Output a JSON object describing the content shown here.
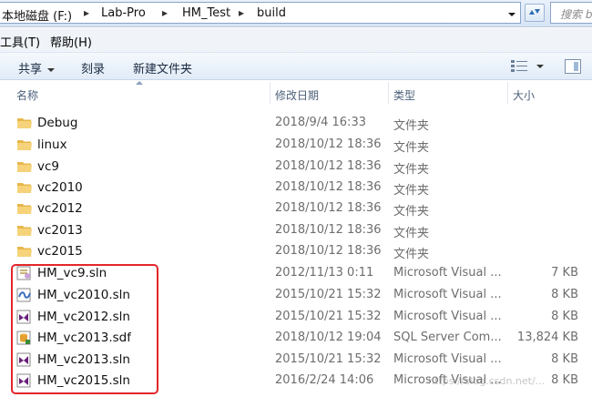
{
  "address": {
    "crumbs": [
      "本地磁盘 (F:)",
      "Lab-Pro",
      "HM_Test",
      "build"
    ],
    "search_placeholder": "搜索 b"
  },
  "menu": {
    "items": [
      "工具(T)",
      "帮助(H)"
    ]
  },
  "toolbar": {
    "share_label": "共享",
    "burn_label": "刻录",
    "new_folder_label": "新建文件夹"
  },
  "columns": {
    "name": "名称",
    "date": "修改日期",
    "type": "类型",
    "size": "大小"
  },
  "files": [
    {
      "name": "Debug",
      "date": "2018/9/4 16:33",
      "type": "文件夹",
      "size": "",
      "icon": "folder-icon"
    },
    {
      "name": "linux",
      "date": "2018/10/12 18:36",
      "type": "文件夹",
      "size": "",
      "icon": "folder-icon"
    },
    {
      "name": "vc9",
      "date": "2018/10/12 18:36",
      "type": "文件夹",
      "size": "",
      "icon": "folder-icon"
    },
    {
      "name": "vc2010",
      "date": "2018/10/12 18:36",
      "type": "文件夹",
      "size": "",
      "icon": "folder-icon"
    },
    {
      "name": "vc2012",
      "date": "2018/10/12 18:36",
      "type": "文件夹",
      "size": "",
      "icon": "folder-icon"
    },
    {
      "name": "vc2013",
      "date": "2018/10/12 18:36",
      "type": "文件夹",
      "size": "",
      "icon": "folder-icon"
    },
    {
      "name": "vc2015",
      "date": "2018/10/12 18:36",
      "type": "文件夹",
      "size": "",
      "icon": "folder-icon"
    },
    {
      "name": "HM_vc9.sln",
      "date": "2012/11/13 0:11",
      "type": "Microsoft Visual ...",
      "size": "7 KB",
      "icon": "vs2008-solution-icon"
    },
    {
      "name": "HM_vc2010.sln",
      "date": "2015/10/21 15:32",
      "type": "Microsoft Visual ...",
      "size": "8 KB",
      "icon": "vs2010-solution-icon"
    },
    {
      "name": "HM_vc2012.sln",
      "date": "2015/10/21 15:32",
      "type": "Microsoft Visual ...",
      "size": "8 KB",
      "icon": "vs-solution-icon"
    },
    {
      "name": "HM_vc2013.sdf",
      "date": "2018/10/12 19:04",
      "type": "SQL Server Com...",
      "size": "13,824 KB",
      "icon": "sql-database-icon"
    },
    {
      "name": "HM_vc2013.sln",
      "date": "2015/10/21 15:32",
      "type": "Microsoft Visual ...",
      "size": "8 KB",
      "icon": "vs-solution-icon"
    },
    {
      "name": "HM_vc2015.sln",
      "date": "2016/2/24 14:06",
      "type": "Microsoft Visual ...",
      "size": "8 KB",
      "icon": "vs-solution-icon"
    }
  ],
  "watermark": "https://blog.csdn.net/..."
}
